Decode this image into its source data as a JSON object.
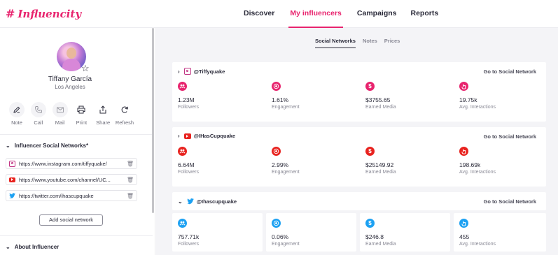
{
  "brand": {
    "name": "Influencity",
    "accent": "#e8246e"
  },
  "nav": [
    {
      "label": "Discover",
      "active": false
    },
    {
      "label": "My influencers",
      "active": true
    },
    {
      "label": "Campaigns",
      "active": false
    },
    {
      "label": "Reports",
      "active": false
    }
  ],
  "profile": {
    "name": "Tiffany García",
    "location": "Los Angeles"
  },
  "actions": [
    {
      "label": "Note",
      "icon": "edit-icon"
    },
    {
      "label": "Call",
      "icon": "phone-icon"
    },
    {
      "label": "Mail",
      "icon": "mail-icon"
    },
    {
      "label": "Print",
      "icon": "printer-icon"
    },
    {
      "label": "Share",
      "icon": "share-icon"
    },
    {
      "label": "Refresh",
      "icon": "refresh-icon"
    }
  ],
  "networks_section": {
    "title": "Influencer Social Networks*",
    "links": [
      {
        "platform": "instagram",
        "url": "https://www.instagram.com/tiffyquake/"
      },
      {
        "platform": "youtube",
        "url": "https://www.youtube.com/channel/UC..."
      },
      {
        "platform": "twitter",
        "url": "https://twitter.com/ihascupquake"
      }
    ],
    "add_button": "Add social network"
  },
  "about_section": {
    "title": "About Influencer"
  },
  "subtabs": [
    {
      "label": "Social Networks",
      "active": true
    },
    {
      "label": "Notes",
      "active": false
    },
    {
      "label": "Prices",
      "active": false
    }
  ],
  "goto_label": "Go to Social Network",
  "metric_labels": [
    "Followers",
    "Engagement",
    "Earned Media",
    "Avg. Interactions"
  ],
  "cards": [
    {
      "platform": "instagram",
      "handle": "@Tiffyquake",
      "color": "#e8246e",
      "values": [
        "1.23M",
        "1.61%",
        "$3755.65",
        "19.75k"
      ]
    },
    {
      "platform": "youtube",
      "handle": "@IHasCupquake",
      "color": "#e8231f",
      "values": [
        "6.64M",
        "2.99%",
        "$25149.92",
        "198.69k"
      ]
    },
    {
      "platform": "twitter",
      "handle": "@Ihascupquake",
      "color": "#1da1f2",
      "values": [
        "757.71k",
        "0.06%",
        "$246.8",
        "455"
      ]
    }
  ]
}
